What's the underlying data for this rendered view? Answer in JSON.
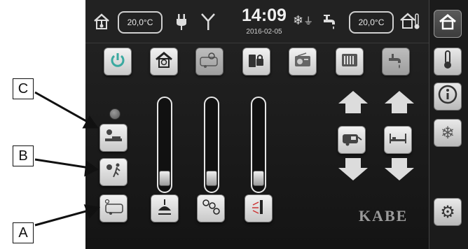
{
  "status": {
    "indoor_temp": "20,0°C",
    "time": "14:09",
    "date": "2016-02-05",
    "outdoor_temp": "20,0°C"
  },
  "sidebar": {
    "items": [
      {
        "name": "home-icon",
        "glyph": "⌂"
      },
      {
        "name": "thermometer-icon",
        "glyph": "🌡"
      },
      {
        "name": "info-icon",
        "glyph": "ⓘ"
      },
      {
        "name": "snowflake-icon",
        "glyph": "❄"
      },
      {
        "name": "settings-icon",
        "glyph": "⚙"
      }
    ]
  },
  "brand": {
    "logo_text": "KABE"
  },
  "callouts": {
    "a": "A",
    "b": "B",
    "c": "C"
  },
  "colors": {
    "screen_bg": "#1c1c1c",
    "button_light": "#e8e8e8",
    "accent_active": "#4a4a4a"
  },
  "sliders": [
    {
      "name": "ceiling-lamp-dimmer",
      "level": 0.1
    },
    {
      "name": "spot-lights-dimmer",
      "level": 0.1
    },
    {
      "name": "wall-light-dimmer",
      "level": 0.1
    }
  ]
}
